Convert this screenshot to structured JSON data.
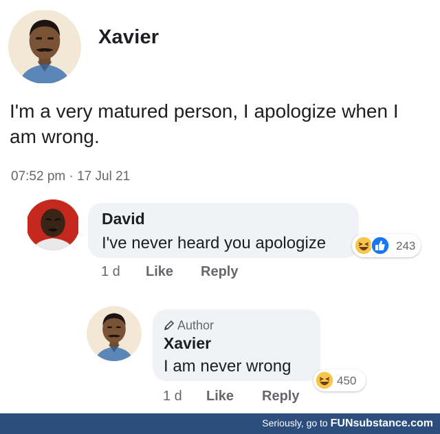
{
  "post": {
    "author": "Xavier",
    "text": "I'm a very matured person, I apologize when I am wrong.",
    "timestamp": "07:52 pm · 17 Jul 21"
  },
  "comments": [
    {
      "author": "David",
      "text": "I've never heard you apologize",
      "reactions": [
        "laughing-face-icon",
        "thumbs-up-icon"
      ],
      "reaction_count": "243",
      "age": "1 d",
      "like_label": "Like",
      "reply_label": "Reply"
    },
    {
      "badge": "Author",
      "author": "Xavier",
      "text": "I am never wrong",
      "reactions": [
        "laughing-face-icon"
      ],
      "reaction_count": "450",
      "age": "1 d",
      "like_label": "Like",
      "reply_label": "Reply"
    }
  ],
  "footer": {
    "prefix": "Seriously, go to",
    "brand": "FUNsubstance.com"
  },
  "colors": {
    "bubble": "#f0f2f5",
    "meta_text": "#65676b",
    "like_blue": "#1877f2",
    "footer_bg": "#2c4e7e"
  }
}
